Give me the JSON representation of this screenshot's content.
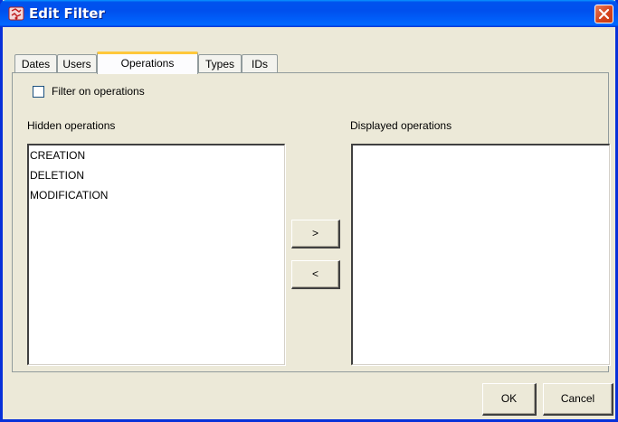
{
  "window": {
    "title": "Edit Filter",
    "colors": {
      "titlebar": "#0053ee",
      "close": "#d5431d",
      "face": "#ece9d8"
    }
  },
  "tabs": [
    {
      "label": "Dates",
      "active": false
    },
    {
      "label": "Users",
      "active": false
    },
    {
      "label": "Operations",
      "active": true
    },
    {
      "label": "Types",
      "active": false
    },
    {
      "label": "IDs",
      "active": false
    }
  ],
  "filter": {
    "checkbox_label": "Filter on operations",
    "checked": false
  },
  "hidden": {
    "label": "Hidden operations",
    "items": [
      "CREATION",
      "DELETION",
      "MODIFICATION"
    ]
  },
  "displayed": {
    "label": "Displayed operations",
    "items": []
  },
  "move": {
    "right_label": ">",
    "left_label": "<"
  },
  "buttons": {
    "ok_label": "OK",
    "cancel_label": "Cancel"
  }
}
